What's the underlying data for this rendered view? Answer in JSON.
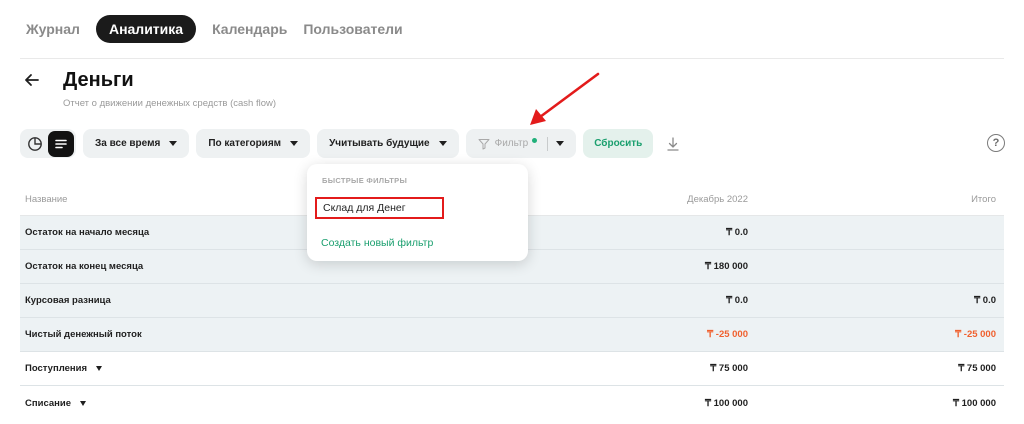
{
  "nav": {
    "tabs": [
      {
        "label": "Журнал",
        "active": false
      },
      {
        "label": "Аналитика",
        "active": true
      },
      {
        "label": "Календарь",
        "active": false
      },
      {
        "label": "Пользователи",
        "active": false
      }
    ]
  },
  "header": {
    "title": "Деньги",
    "subtitle": "Отчет о движении денежных средств (cash flow)"
  },
  "toolbar": {
    "view_icons": [
      "pie-chart-icon",
      "table-list-icon"
    ],
    "period_label": "За все время",
    "grouping_label": "По категориям",
    "future_label": "Учитывать будущие",
    "filter_label": "Фильтр",
    "reset_label": "Сбросить",
    "download_icon": "download-icon",
    "help_label": "?"
  },
  "filter_popup": {
    "header": "БЫСТРЫЕ ФИЛЬТРЫ",
    "item": "Склад для Денег",
    "create_label": "Создать новый фильтр"
  },
  "table": {
    "columns": [
      "Название",
      "Декабрь 2022",
      "Итого"
    ],
    "rows": [
      {
        "name": "Остаток на начало месяца",
        "dec": "₸ 0.0",
        "total": "",
        "shaded": true
      },
      {
        "name": "Остаток на конец месяца",
        "dec": "₸ 180 000",
        "total": "",
        "shaded": true
      },
      {
        "name": "Курсовая разница",
        "dec": "₸ 0.0",
        "total": "₸ 0.0",
        "shaded": true
      },
      {
        "name": "Чистый денежный поток",
        "dec": "₸ -25 000",
        "total": "₸ -25 000",
        "shaded": true,
        "negative": true
      },
      {
        "name": "Поступления",
        "dec": "₸ 75 000",
        "total": "₸ 75 000",
        "shaded": false,
        "expandable": true
      },
      {
        "name": "Списание",
        "dec": "₸ 100 000",
        "total": "₸ 100 000",
        "shaded": false,
        "expandable": true
      }
    ]
  },
  "colors": {
    "accent_green": "#1a9f6e",
    "negative": "#f0602e",
    "annotation_red": "#e31b1b"
  }
}
